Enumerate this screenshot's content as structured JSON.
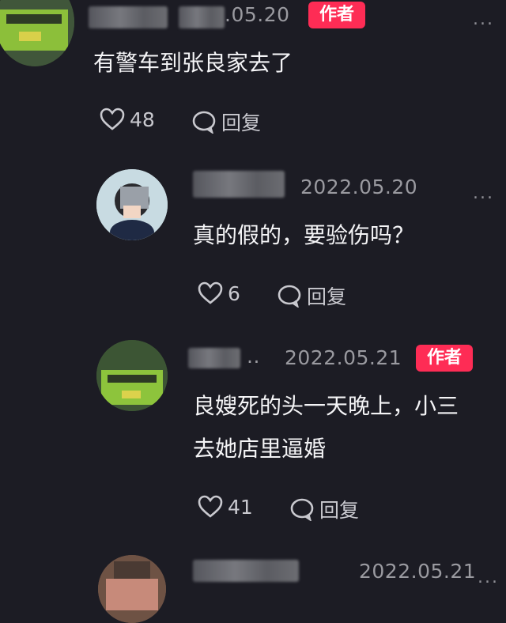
{
  "comments": [
    {
      "id": "c1",
      "date": ".05.20",
      "badge": "作者",
      "text": "有警车到张良家去了",
      "likes": "48",
      "reply_label": "回复",
      "more": "..."
    },
    {
      "id": "c2",
      "date": "2022.05.20",
      "text": "真的假的，要验伤吗？",
      "likes": "6",
      "reply_label": "回复",
      "more": "..."
    },
    {
      "id": "c3",
      "date": "2022.05.21",
      "badge": "作者",
      "name_suffix": "..",
      "text_line1": "良嫂死的头一天晚上，小三",
      "text_line2": "去她店里逼婚",
      "likes": "41",
      "reply_label": "回复"
    },
    {
      "id": "c4",
      "date": "2022.05.21",
      "more": "..."
    }
  ],
  "colors": {
    "background": "#1c1c24",
    "badge": "#fe2c55",
    "date": "#9a9aa0"
  }
}
